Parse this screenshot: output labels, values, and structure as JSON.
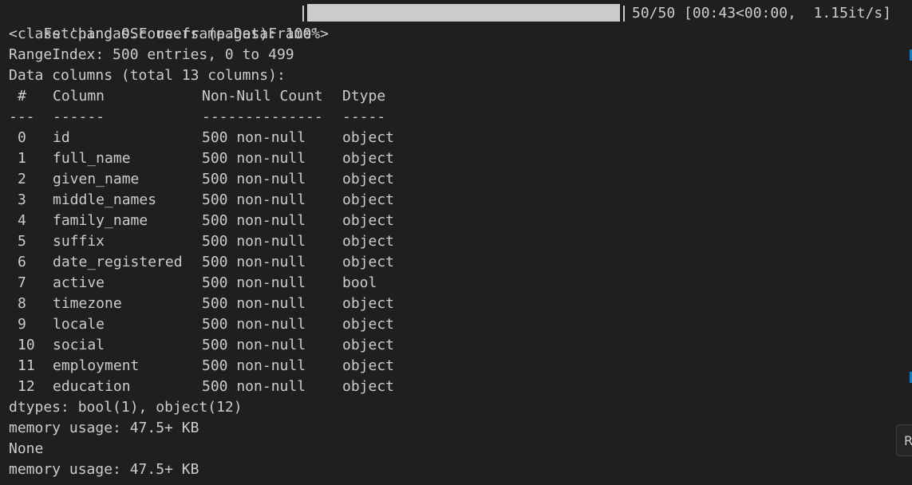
{
  "progress": {
    "prefix": "Fetching OSF users (pages): 100%",
    "fraction": 1.0,
    "suffix": "50/50 [00:43<00:00,  1.15it/s]"
  },
  "output_lines": {
    "class_line": "<class 'pandas.core.frame.DataFrame'>",
    "range_index": "RangeIndex: 500 entries, 0 to 499",
    "data_columns": "Data columns (total 13 columns):"
  },
  "table": {
    "headers": {
      "num": "#",
      "column": "Column",
      "count": "Non-Null Count",
      "dtype": "Dtype"
    },
    "separators": {
      "num": "---",
      "column": "------",
      "count": "--------------",
      "dtype": "-----"
    },
    "rows": [
      {
        "num": "0",
        "column": "id",
        "count": "500 non-null",
        "dtype": "object"
      },
      {
        "num": "1",
        "column": "full_name",
        "count": "500 non-null",
        "dtype": "object"
      },
      {
        "num": "2",
        "column": "given_name",
        "count": "500 non-null",
        "dtype": "object"
      },
      {
        "num": "3",
        "column": "middle_names",
        "count": "500 non-null",
        "dtype": "object"
      },
      {
        "num": "4",
        "column": "family_name",
        "count": "500 non-null",
        "dtype": "object"
      },
      {
        "num": "5",
        "column": "suffix",
        "count": "500 non-null",
        "dtype": "object"
      },
      {
        "num": "6",
        "column": "date_registered",
        "count": "500 non-null",
        "dtype": "object"
      },
      {
        "num": "7",
        "column": "active",
        "count": "500 non-null",
        "dtype": "bool"
      },
      {
        "num": "8",
        "column": "timezone",
        "count": "500 non-null",
        "dtype": "object"
      },
      {
        "num": "9",
        "column": "locale",
        "count": "500 non-null",
        "dtype": "object"
      },
      {
        "num": "10",
        "column": "social",
        "count": "500 non-null",
        "dtype": "object"
      },
      {
        "num": "11",
        "column": "employment",
        "count": "500 non-null",
        "dtype": "object"
      },
      {
        "num": "12",
        "column": "education",
        "count": "500 non-null",
        "dtype": "object"
      }
    ]
  },
  "footer_lines": {
    "dtypes": "dtypes: bool(1), object(12)",
    "memory1": "memory usage: 47.5+ KB",
    "none": "None",
    "memory2": "memory usage: 47.5+ KB"
  },
  "edge_tab_label": "R",
  "colors": {
    "background": "#1f1f1f",
    "text": "#cccccc",
    "scroll_marker": "#0e7ec0"
  }
}
